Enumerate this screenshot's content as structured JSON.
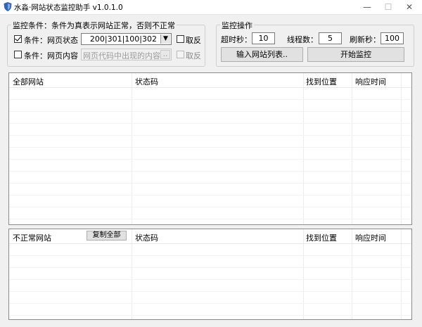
{
  "window": {
    "title": "水淼·网站状态监控助手 v1.0.1.0",
    "minimize_glyph": "—",
    "maximize_glyph": "☐",
    "close_glyph": "✕"
  },
  "conditions": {
    "group_title": "监控条件：条件为真表示网站正常，否则不正常",
    "cond1": {
      "checked": true,
      "label": "条件：网页状态",
      "value": "200|301|100|302",
      "dropdown_glyph": "▼",
      "invert_label": "取反",
      "invert_checked": false
    },
    "cond2": {
      "checked": false,
      "label": "条件：网页内容",
      "placeholder": "网页代码中出现的内容",
      "browse_label": "..",
      "invert_label": "取反",
      "invert_checked": false
    }
  },
  "operations": {
    "group_title": "监控操作",
    "timeout_label": "超时秒：",
    "timeout_value": "10",
    "threads_label": "线程数：",
    "threads_value": "5",
    "refresh_label": "刷新秒：",
    "refresh_value": "100",
    "import_button": "输入网站列表..",
    "start_button": "开始监控"
  },
  "all_sites": {
    "columns": [
      "全部网站",
      "状态码",
      "找到位置",
      "响应时间"
    ]
  },
  "abnormal_sites": {
    "columns": [
      "不正常网站",
      "状态码",
      "找到位置",
      "响应时间"
    ],
    "copy_button": "复制全部"
  },
  "colors": {
    "background": "#f0f0f0",
    "list_background": "#ffffff",
    "icon_blue": "#2f64b8"
  }
}
